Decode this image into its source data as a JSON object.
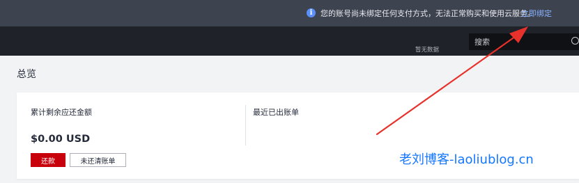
{
  "notice": {
    "message": "您的账号尚未绑定任何支付方式，无法正常购买和使用云服务。",
    "link_label": "立即绑定",
    "info_icon": "info-icon"
  },
  "search": {
    "placeholder": "搜索"
  },
  "page": {
    "title": "总览"
  },
  "overview": {
    "repayment_title": "累计剩余应还金额",
    "amount": "$0.00 USD",
    "repay_button": "还款",
    "unpaid_bills_button": "未还清账单",
    "recent_bills_title": "最近已出账单",
    "no_data": "暂无数据"
  },
  "watermark": "老刘博客-laoliublog.cn",
  "colors": {
    "notice_bg": "#3e4350",
    "topbar_bg": "#1f2329",
    "primary_red": "#c7000b",
    "link_blue": "#8ab4ff",
    "arrow_red": "#e8312a"
  }
}
